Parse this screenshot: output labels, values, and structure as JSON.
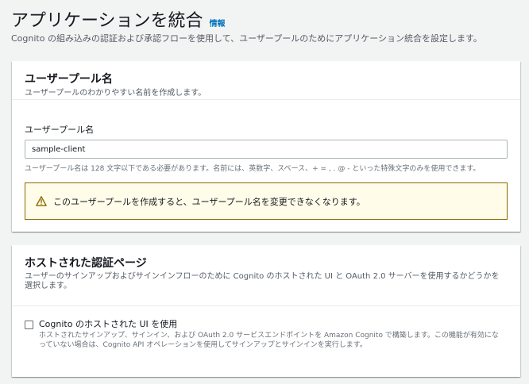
{
  "header": {
    "title": "アプリケーションを統合",
    "info_link": "情報",
    "description": "Cognito の組み込みの認証および承認フローを使用して、ユーザープールのためにアプリケーション統合を設定します。"
  },
  "user_pool_name_section": {
    "title": "ユーザープール名",
    "subtitle": "ユーザープールのわかりやすい名前を作成します。",
    "field_label": "ユーザープール名",
    "field_value": "sample-client",
    "field_hint": "ユーザープール名は 128 文字以下である必要があります。名前には、英数字、スペース、+ = , . @ - といった特殊文字のみを使用できます。",
    "alert_icon": "warning-icon",
    "alert_text": "このユーザープールを作成すると、ユーザープール名を変更できなくなります。",
    "alert_color": "#8c6b00"
  },
  "hosted_ui_section": {
    "title": "ホストされた認証ページ",
    "subtitle": "ユーザーのサインアップおよびサインインフローのために Cognito のホストされた UI と OAuth 2.0 サーバーを使用するかどうかを選択します。",
    "checkbox_label": "Cognito のホストされた UI を使用",
    "checkbox_checked": false,
    "checkbox_desc": "ホストされたサインアップ、サインイン、および OAuth 2.0 サービスエンドポイントを Amazon Cognito で構築します。この機能が有効になっていない場合は、Cognito API オペレーションを使用してサインアップとサインインを実行します。"
  },
  "colors": {
    "link": "#0073bb",
    "background": "#f2f3f3",
    "text": "#16191f",
    "secondary_text": "#545b64"
  }
}
